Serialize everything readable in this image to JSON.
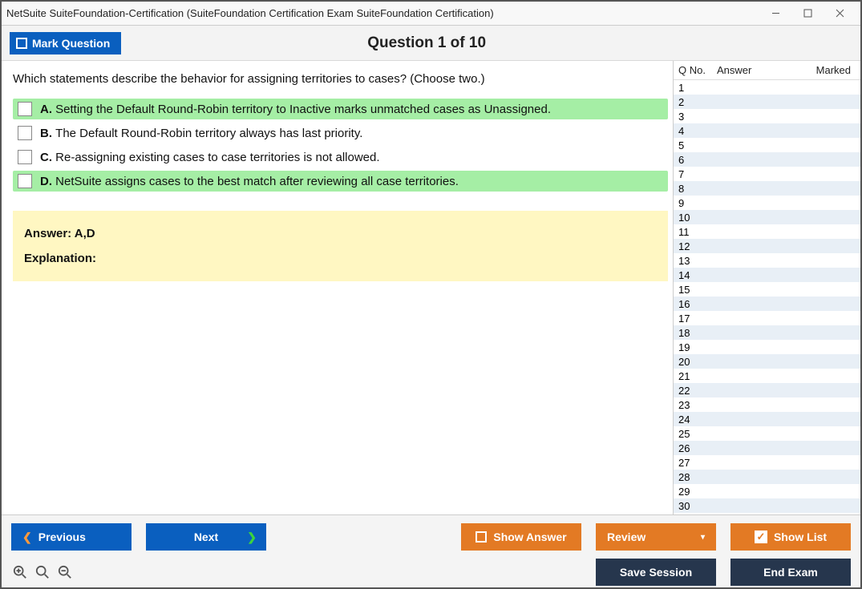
{
  "titlebar": {
    "text": "NetSuite SuiteFoundation-Certification (SuiteFoundation Certification Exam SuiteFoundation Certification)"
  },
  "header": {
    "mark_label": "Mark Question",
    "question_title": "Question 1 of 10"
  },
  "question": {
    "text": "Which statements describe the behavior for assigning territories to cases? (Choose two.)",
    "choices": [
      {
        "letter": "A.",
        "text": "Setting the Default Round-Robin territory to Inactive marks unmatched cases as Unassigned.",
        "highlight": true
      },
      {
        "letter": "B.",
        "text": "The Default Round-Robin territory always has last priority.",
        "highlight": false
      },
      {
        "letter": "C.",
        "text": "Re-assigning existing cases to case territories is not allowed.",
        "highlight": false
      },
      {
        "letter": "D.",
        "text": "NetSuite assigns cases to the best match after reviewing all case territories.",
        "highlight": true
      }
    ],
    "answer_label": "Answer: A,D",
    "explanation_label": "Explanation:"
  },
  "sidebar": {
    "headers": {
      "qno": "Q No.",
      "answer": "Answer",
      "marked": "Marked"
    },
    "rows": [
      {
        "qno": "1"
      },
      {
        "qno": "2"
      },
      {
        "qno": "3"
      },
      {
        "qno": "4"
      },
      {
        "qno": "5"
      },
      {
        "qno": "6"
      },
      {
        "qno": "7"
      },
      {
        "qno": "8"
      },
      {
        "qno": "9"
      },
      {
        "qno": "10"
      },
      {
        "qno": "11"
      },
      {
        "qno": "12"
      },
      {
        "qno": "13"
      },
      {
        "qno": "14"
      },
      {
        "qno": "15"
      },
      {
        "qno": "16"
      },
      {
        "qno": "17"
      },
      {
        "qno": "18"
      },
      {
        "qno": "19"
      },
      {
        "qno": "20"
      },
      {
        "qno": "21"
      },
      {
        "qno": "22"
      },
      {
        "qno": "23"
      },
      {
        "qno": "24"
      },
      {
        "qno": "25"
      },
      {
        "qno": "26"
      },
      {
        "qno": "27"
      },
      {
        "qno": "28"
      },
      {
        "qno": "29"
      },
      {
        "qno": "30"
      }
    ]
  },
  "footer": {
    "previous": "Previous",
    "next": "Next",
    "show_answer": "Show Answer",
    "review": "Review",
    "show_list": "Show List",
    "save_session": "Save Session",
    "end_exam": "End Exam"
  }
}
